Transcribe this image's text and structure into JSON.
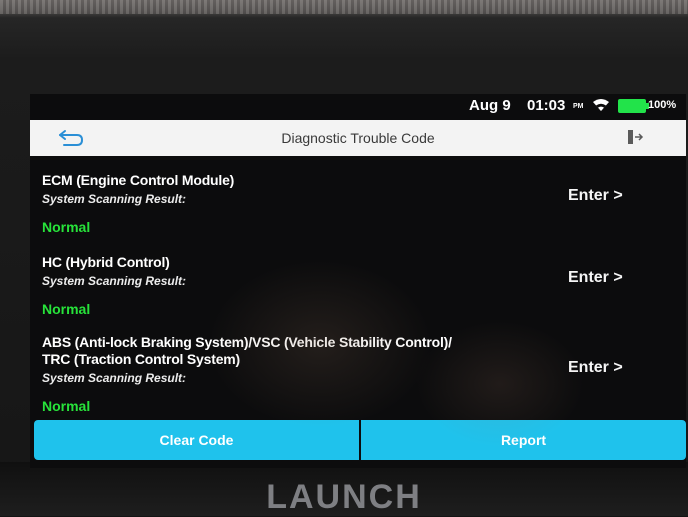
{
  "status_bar": {
    "date": "Aug 9",
    "time": "01:03",
    "ampm": "PM",
    "battery": "100%",
    "wifi_icon": "wifi-icon",
    "battery_icon": "battery-full-icon"
  },
  "header": {
    "title": "Diagnostic Trouble Code",
    "back_icon": "back-arrow-icon",
    "exit_icon": "exit-icon"
  },
  "systems": [
    {
      "name_lines": [
        "ECM (Engine Control Module)"
      ],
      "caption": "System Scanning Result:",
      "status": "Normal",
      "enter_label": "Enter >"
    },
    {
      "name_lines": [
        "HC (Hybrid Control)"
      ],
      "caption": "System Scanning Result:",
      "status": "Normal",
      "enter_label": "Enter >"
    },
    {
      "name_lines": [
        "ABS (Anti-lock Braking System)/VSC (Vehicle Stability Control)/",
        "TRC (Traction Control System)"
      ],
      "caption": "System Scanning Result:",
      "status": "Normal",
      "enter_label": "Enter >"
    }
  ],
  "actions": {
    "clear_code": "Clear Code",
    "report": "Report"
  },
  "brand": "LAUNCH",
  "colors": {
    "accent": "#1fc2ec",
    "status_normal": "#27e33a",
    "battery": "#22e34a",
    "title_bar": "#f3f3f3"
  }
}
